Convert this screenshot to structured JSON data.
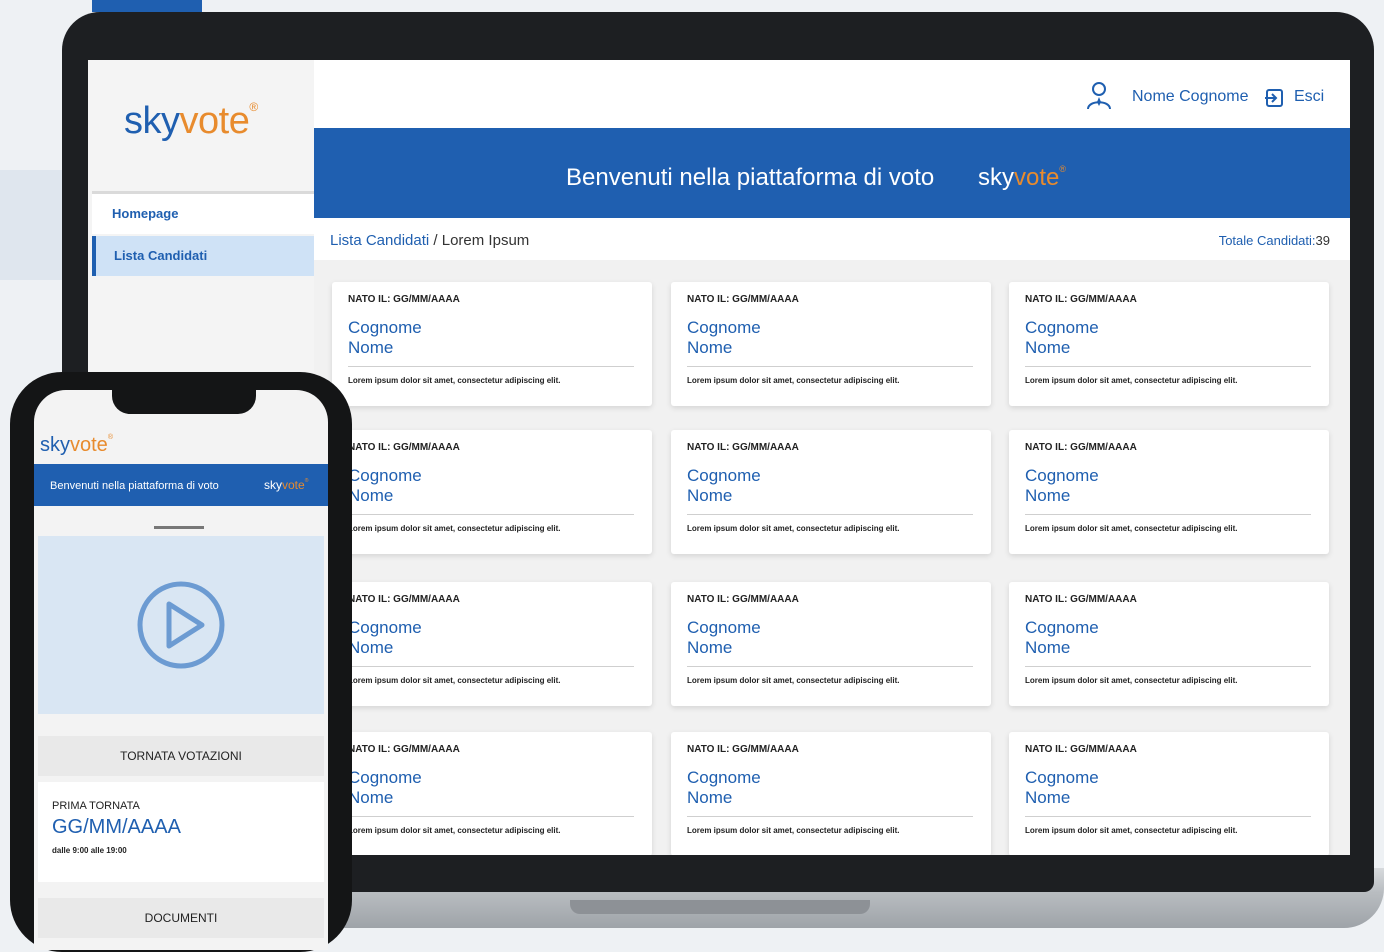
{
  "brand": {
    "sky": "sky",
    "vote": "vote",
    "reg": "®"
  },
  "colors": {
    "primary": "#1f5fb0",
    "accent": "#e88b2d",
    "active_nav": "#cfe2f6"
  },
  "sidebar": {
    "items": [
      {
        "label": "Homepage",
        "active": false
      },
      {
        "label": "Lista Candidati",
        "active": true
      }
    ]
  },
  "header": {
    "user_name": "Nome Cognome",
    "exit_label": "Esci",
    "user_icon": "user-avatar-icon",
    "exit_icon": "logout-icon"
  },
  "banner": {
    "text": "Benvenuti nella piattaforma di voto"
  },
  "breadcrumb": {
    "section": "Lista Candidati",
    "separator": " / ",
    "page": "Lorem Ipsum"
  },
  "totals": {
    "label": "Totale Candidati:",
    "count": "39"
  },
  "card_template": {
    "dob": "NATO IL: GG/MM/AAAA",
    "surname": "Cognome",
    "name": "Nome",
    "desc": "Lorem ipsum dolor sit amet, consectetur adipiscing elit."
  },
  "cards": [
    {
      "dob": "NATO IL: GG/MM/AAAA",
      "surname": "Cognome",
      "name": "Nome",
      "desc": "Lorem ipsum dolor sit amet, consectetur adipiscing elit."
    },
    {
      "dob": "NATO IL: GG/MM/AAAA",
      "surname": "Cognome",
      "name": "Nome",
      "desc": "Lorem ipsum dolor sit amet, consectetur adipiscing elit."
    },
    {
      "dob": "NATO IL: GG/MM/AAAA",
      "surname": "Cognome",
      "name": "Nome",
      "desc": "Lorem ipsum dolor sit amet, consectetur adipiscing elit."
    },
    {
      "dob": "NATO IL: GG/MM/AAAA",
      "surname": "Cognome",
      "name": "Nome",
      "desc": "Lorem ipsum dolor sit amet, consectetur adipiscing elit."
    },
    {
      "dob": "NATO IL: GG/MM/AAAA",
      "surname": "Cognome",
      "name": "Nome",
      "desc": "Lorem ipsum dolor sit amet, consectetur adipiscing elit."
    },
    {
      "dob": "NATO IL: GG/MM/AAAA",
      "surname": "Cognome",
      "name": "Nome",
      "desc": "Lorem ipsum dolor sit amet, consectetur adipiscing elit."
    },
    {
      "dob": "NATO IL: GG/MM/AAAA",
      "surname": "Cognome",
      "name": "Nome",
      "desc": "Lorem ipsum dolor sit amet, consectetur adipiscing elit."
    },
    {
      "dob": "NATO IL: GG/MM/AAAA",
      "surname": "Cognome",
      "name": "Nome",
      "desc": "Lorem ipsum dolor sit amet, consectetur adipiscing elit."
    },
    {
      "dob": "NATO IL: GG/MM/AAAA",
      "surname": "Cognome",
      "name": "Nome",
      "desc": "Lorem ipsum dolor sit amet, consectetur adipiscing elit."
    },
    {
      "dob": "NATO IL: GG/MM/AAAA",
      "surname": "Cognome",
      "name": "Nome",
      "desc": "Lorem ipsum dolor sit amet, consectetur adipiscing elit."
    },
    {
      "dob": "NATO IL: GG/MM/AAAA",
      "surname": "Cognome",
      "name": "Nome",
      "desc": "Lorem ipsum dolor sit amet, consectetur adipiscing elit."
    },
    {
      "dob": "NATO IL: GG/MM/AAAA",
      "surname": "Cognome",
      "name": "Nome",
      "desc": "Lorem ipsum dolor sit amet, consectetur adipiscing elit."
    }
  ],
  "mobile": {
    "banner_text": "Benvenuti nella piattaforma di voto",
    "video_icon": "play-icon",
    "sections": {
      "tornata": "TORNATA VOTAZIONI",
      "documents": "DOCUMENTI"
    },
    "round": {
      "label": "PRIMA TORNATA",
      "date": "GG/MM/AAAA",
      "time": "dalle 9:00 alle 19:00"
    }
  }
}
